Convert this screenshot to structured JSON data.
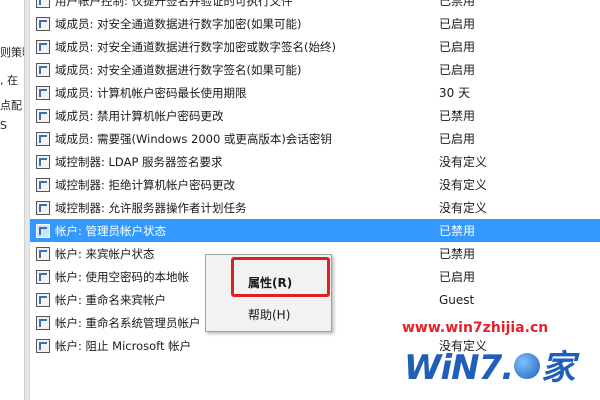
{
  "left_pane": {
    "fragments": [
      "则策略",
      ", 在",
      "点配",
      "S"
    ]
  },
  "policy_list": {
    "rows": [
      {
        "name": "用户帐户控制: 仅提升签名并验证的可执行文件",
        "value": "已禁用"
      },
      {
        "name": "域成员: 对安全通道数据进行数字加密(如果可能)",
        "value": "已启用"
      },
      {
        "name": "域成员: 对安全通道数据进行数字加密或数字签名(始终)",
        "value": "已启用"
      },
      {
        "name": "域成员: 对安全通道数据进行数字签名(如果可能)",
        "value": "已启用"
      },
      {
        "name": "域成员: 计算机帐户密码最长使用期限",
        "value": "30 天"
      },
      {
        "name": "域成员: 禁用计算机帐户密码更改",
        "value": "已禁用"
      },
      {
        "name": "域成员: 需要强(Windows 2000 或更高版本)会话密钥",
        "value": "已启用"
      },
      {
        "name": "域控制器: LDAP 服务器签名要求",
        "value": "没有定义"
      },
      {
        "name": "域控制器: 拒绝计算机帐户密码更改",
        "value": "没有定义"
      },
      {
        "name": "域控制器: 允许服务器操作者计划任务",
        "value": "没有定义"
      },
      {
        "name": "帐户: 管理员帐户状态",
        "value": "已禁用"
      },
      {
        "name": "帐户: 来宾帐户状态",
        "value": "已禁用"
      },
      {
        "name": "帐户: 使用空密码的本地帐",
        "value": "已启用"
      },
      {
        "name": "帐户: 重命名来宾帐户",
        "value": "Guest"
      },
      {
        "name": "帐户: 重命名系统管理员帐户",
        "value": ""
      },
      {
        "name": "帐户: 阻止 Microsoft 帐户",
        "value": "没有定义"
      }
    ],
    "selected_index": 10
  },
  "context_menu": {
    "items": [
      {
        "label": "属性(R)",
        "bold": true
      },
      {
        "label": "帮助(H)",
        "bold": false
      }
    ]
  },
  "watermark": {
    "url": "www.win7zhijia.cn",
    "logo_left": "WiN7.",
    "logo_right": "家"
  },
  "colors": {
    "selection": "#3399ff",
    "highlight_box": "#e02020",
    "watermark_url": "#e8202a",
    "watermark_logo": "#1f5fb8"
  }
}
